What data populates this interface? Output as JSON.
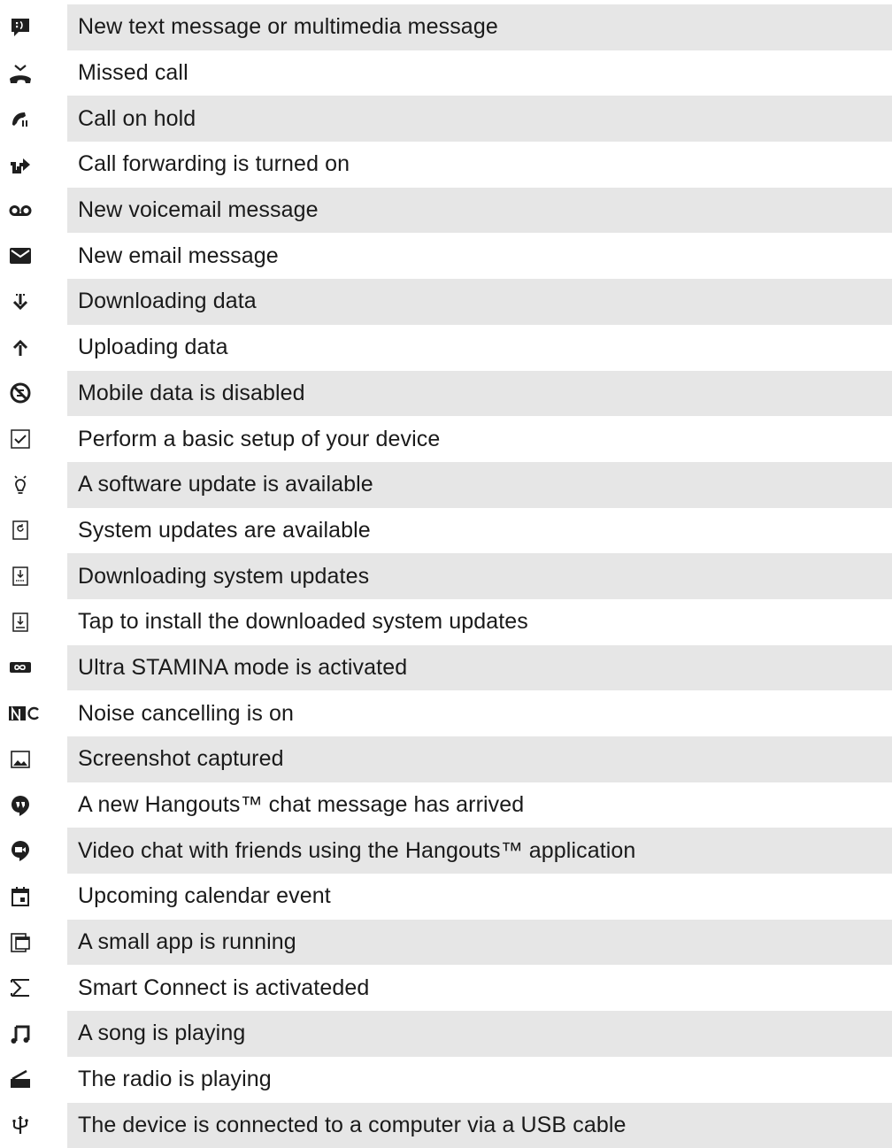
{
  "rows": [
    {
      "icon": "sms-icon",
      "text": "New text message or multimedia message"
    },
    {
      "icon": "missed-call-icon",
      "text": "Missed call"
    },
    {
      "icon": "call-on-hold-icon",
      "text": "Call on hold"
    },
    {
      "icon": "call-forwarding-icon",
      "text": "Call forwarding is turned on"
    },
    {
      "icon": "voicemail-icon",
      "text": "New voicemail message"
    },
    {
      "icon": "email-icon",
      "text": "New email message"
    },
    {
      "icon": "download-icon",
      "text": "Downloading data"
    },
    {
      "icon": "upload-icon",
      "text": "Uploading data"
    },
    {
      "icon": "mobile-data-disabled-icon",
      "text": "Mobile data is disabled"
    },
    {
      "icon": "setup-checkbox-icon",
      "text": "Perform a basic setup of your device"
    },
    {
      "icon": "software-update-bulb-icon",
      "text": "A software update is available"
    },
    {
      "icon": "system-update-icon",
      "text": "System updates are available"
    },
    {
      "icon": "downloading-system-update-icon",
      "text": "Downloading system updates"
    },
    {
      "icon": "install-update-icon",
      "text": "Tap to install the downloaded system updates"
    },
    {
      "icon": "ultra-stamina-icon",
      "text": "Ultra STAMINA mode is activated"
    },
    {
      "icon": "noise-cancelling-icon",
      "text": "Noise cancelling is on"
    },
    {
      "icon": "screenshot-icon",
      "text": "Screenshot captured"
    },
    {
      "icon": "hangouts-chat-icon",
      "text": "A new Hangouts™ chat message has arrived"
    },
    {
      "icon": "hangouts-video-icon",
      "text": "Video chat with friends using the Hangouts™ application"
    },
    {
      "icon": "calendar-icon",
      "text": "Upcoming calendar event"
    },
    {
      "icon": "small-app-icon",
      "text": "A small app is running"
    },
    {
      "icon": "smart-connect-icon",
      "text": "Smart Connect is activateded"
    },
    {
      "icon": "music-note-icon",
      "text": "A song is playing"
    },
    {
      "icon": "radio-icon",
      "text": "The radio is playing"
    },
    {
      "icon": "usb-icon",
      "text": "The device is connected to a computer via a USB cable"
    }
  ],
  "colors": {
    "icon": "#1f1f1f",
    "row_shade": "#e6e6e6",
    "text": "#1a1a1a"
  }
}
